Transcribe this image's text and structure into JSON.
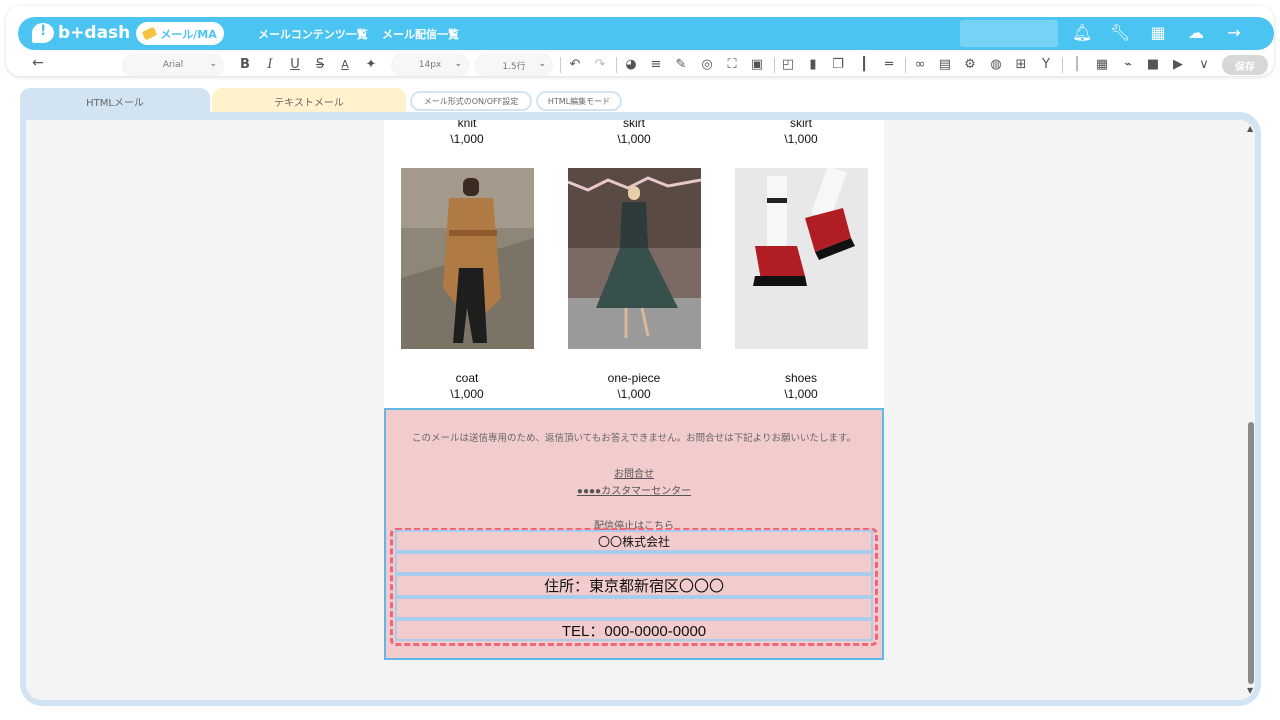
{
  "header": {
    "logo_text": "b+dash",
    "nav_pill": "メール/MA",
    "nav_links": [
      "メールコンテンツ一覧",
      "メール配信一覧"
    ]
  },
  "toolbar": {
    "font_family": "Arial",
    "font_size": "14px",
    "line_height": "1.5行",
    "save_label": "保存"
  },
  "tabs": {
    "html_tab": "HTMLメール",
    "text_tab": "テキストメール",
    "onoff_button": "メール形式のON/OFF設定",
    "html_edit_button": "HTML編集モード"
  },
  "products_top": [
    {
      "name": "knit",
      "price": "\\1,000"
    },
    {
      "name": "skirt",
      "price": "\\1,000"
    },
    {
      "name": "skirt",
      "price": "\\1,000"
    }
  ],
  "products_bottom": [
    {
      "name": "coat",
      "price": "\\1,000"
    },
    {
      "name": "one-piece",
      "price": "\\1,000"
    },
    {
      "name": "shoes",
      "price": "\\1,000"
    }
  ],
  "footer": {
    "note": "このメールは送信専用のため、返信頂いてもお答えできません。お問合せは下記よりお願いいたします。",
    "contact_link": "お問合せ",
    "center_link": "●●●●カスタマーセンター",
    "unsubscribe_link": "配信停止はこちら",
    "company": "〇〇株式会社",
    "address": "住所：東京都新宿区〇〇〇",
    "tel": "TEL：000-0000-0000"
  },
  "colors": {
    "brand": "#4cc4f2",
    "footer_bg": "#f2cccc",
    "selection_border": "#5fb8e8",
    "dashed_border": "#ee6677"
  }
}
